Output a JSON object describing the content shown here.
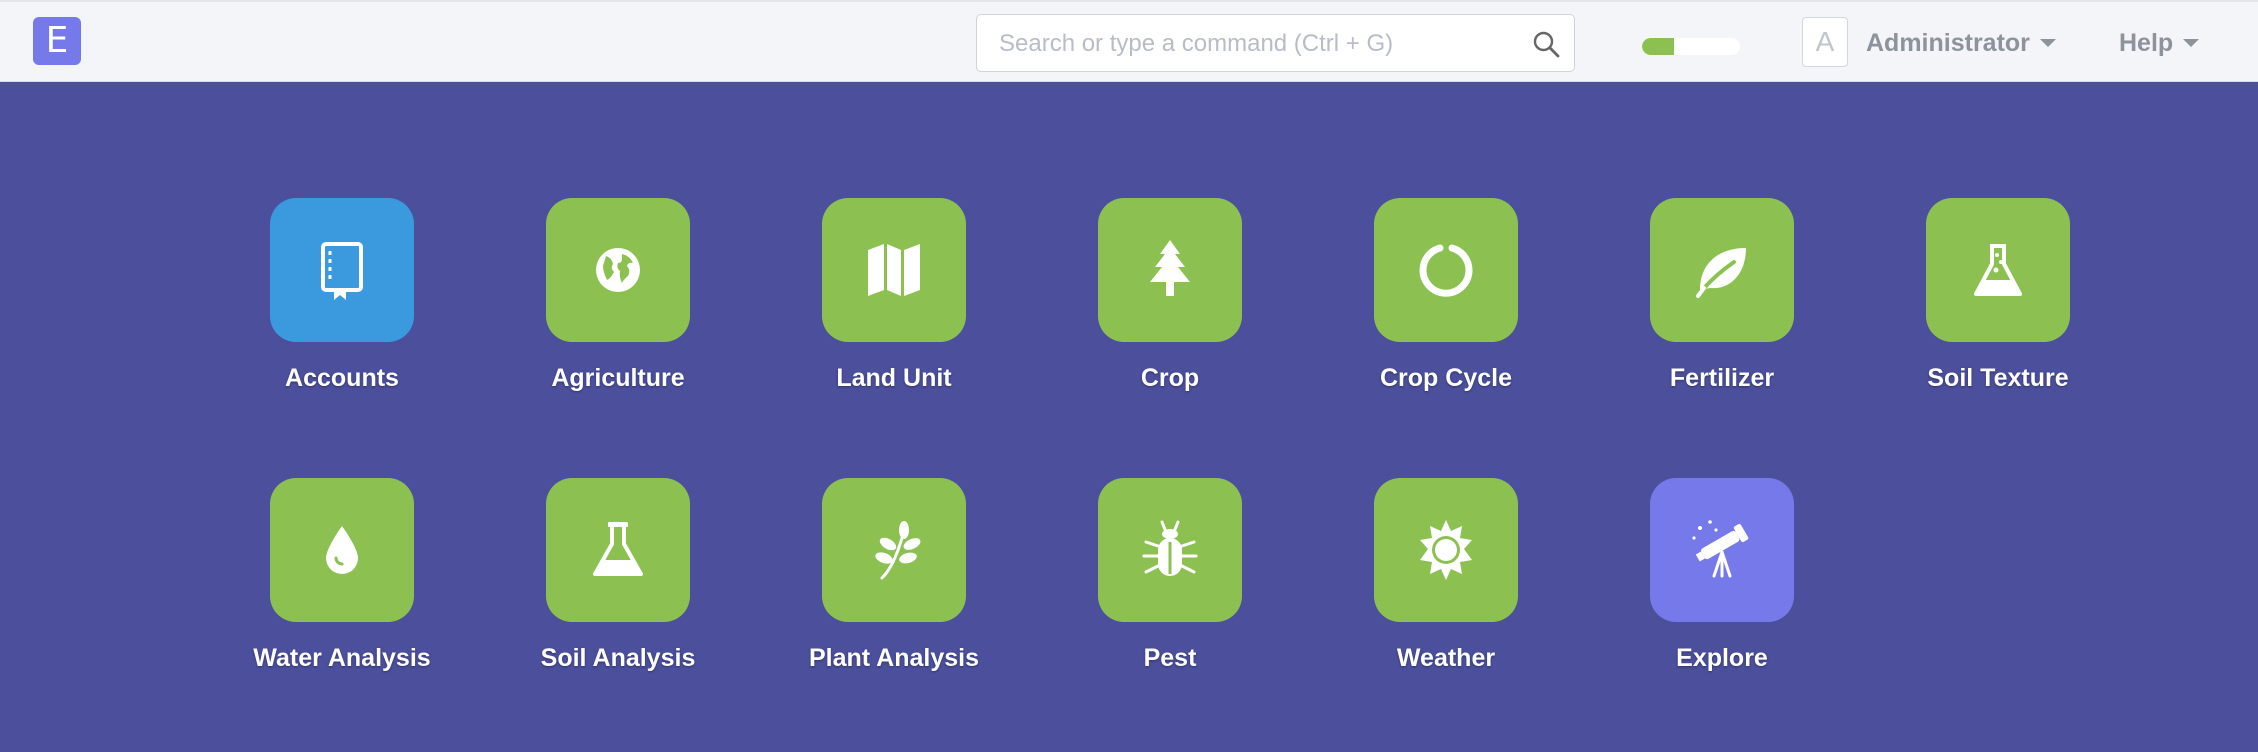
{
  "navbar": {
    "logo": "E",
    "search_placeholder": "Search or type a command (Ctrl + G)",
    "progress_fraction": 0.33,
    "avatar_letter": "A",
    "user_name": "Administrator",
    "help_label": "Help"
  },
  "colors": {
    "background": "#4b4f9c",
    "green": "#8cc152",
    "blue": "#3b9ade",
    "purple": "#7679ea"
  },
  "modules": [
    {
      "label": "Accounts",
      "icon": "book-icon"
    },
    {
      "label": "Agriculture",
      "icon": "globe-icon"
    },
    {
      "label": "Land Unit",
      "icon": "map-icon"
    },
    {
      "label": "Crop",
      "icon": "tree-icon"
    },
    {
      "label": "Crop Cycle",
      "icon": "circle-notch-icon"
    },
    {
      "label": "Fertilizer",
      "icon": "leaf-icon"
    },
    {
      "label": "Soil Texture",
      "icon": "flask-bubbles-icon"
    },
    {
      "label": "Water Analysis",
      "icon": "droplet-icon"
    },
    {
      "label": "Soil Analysis",
      "icon": "flask-icon"
    },
    {
      "label": "Plant Analysis",
      "icon": "sprig-icon"
    },
    {
      "label": "Pest",
      "icon": "bug-icon"
    },
    {
      "label": "Weather",
      "icon": "sun-icon"
    },
    {
      "label": "Explore",
      "icon": "telescope-icon"
    }
  ]
}
